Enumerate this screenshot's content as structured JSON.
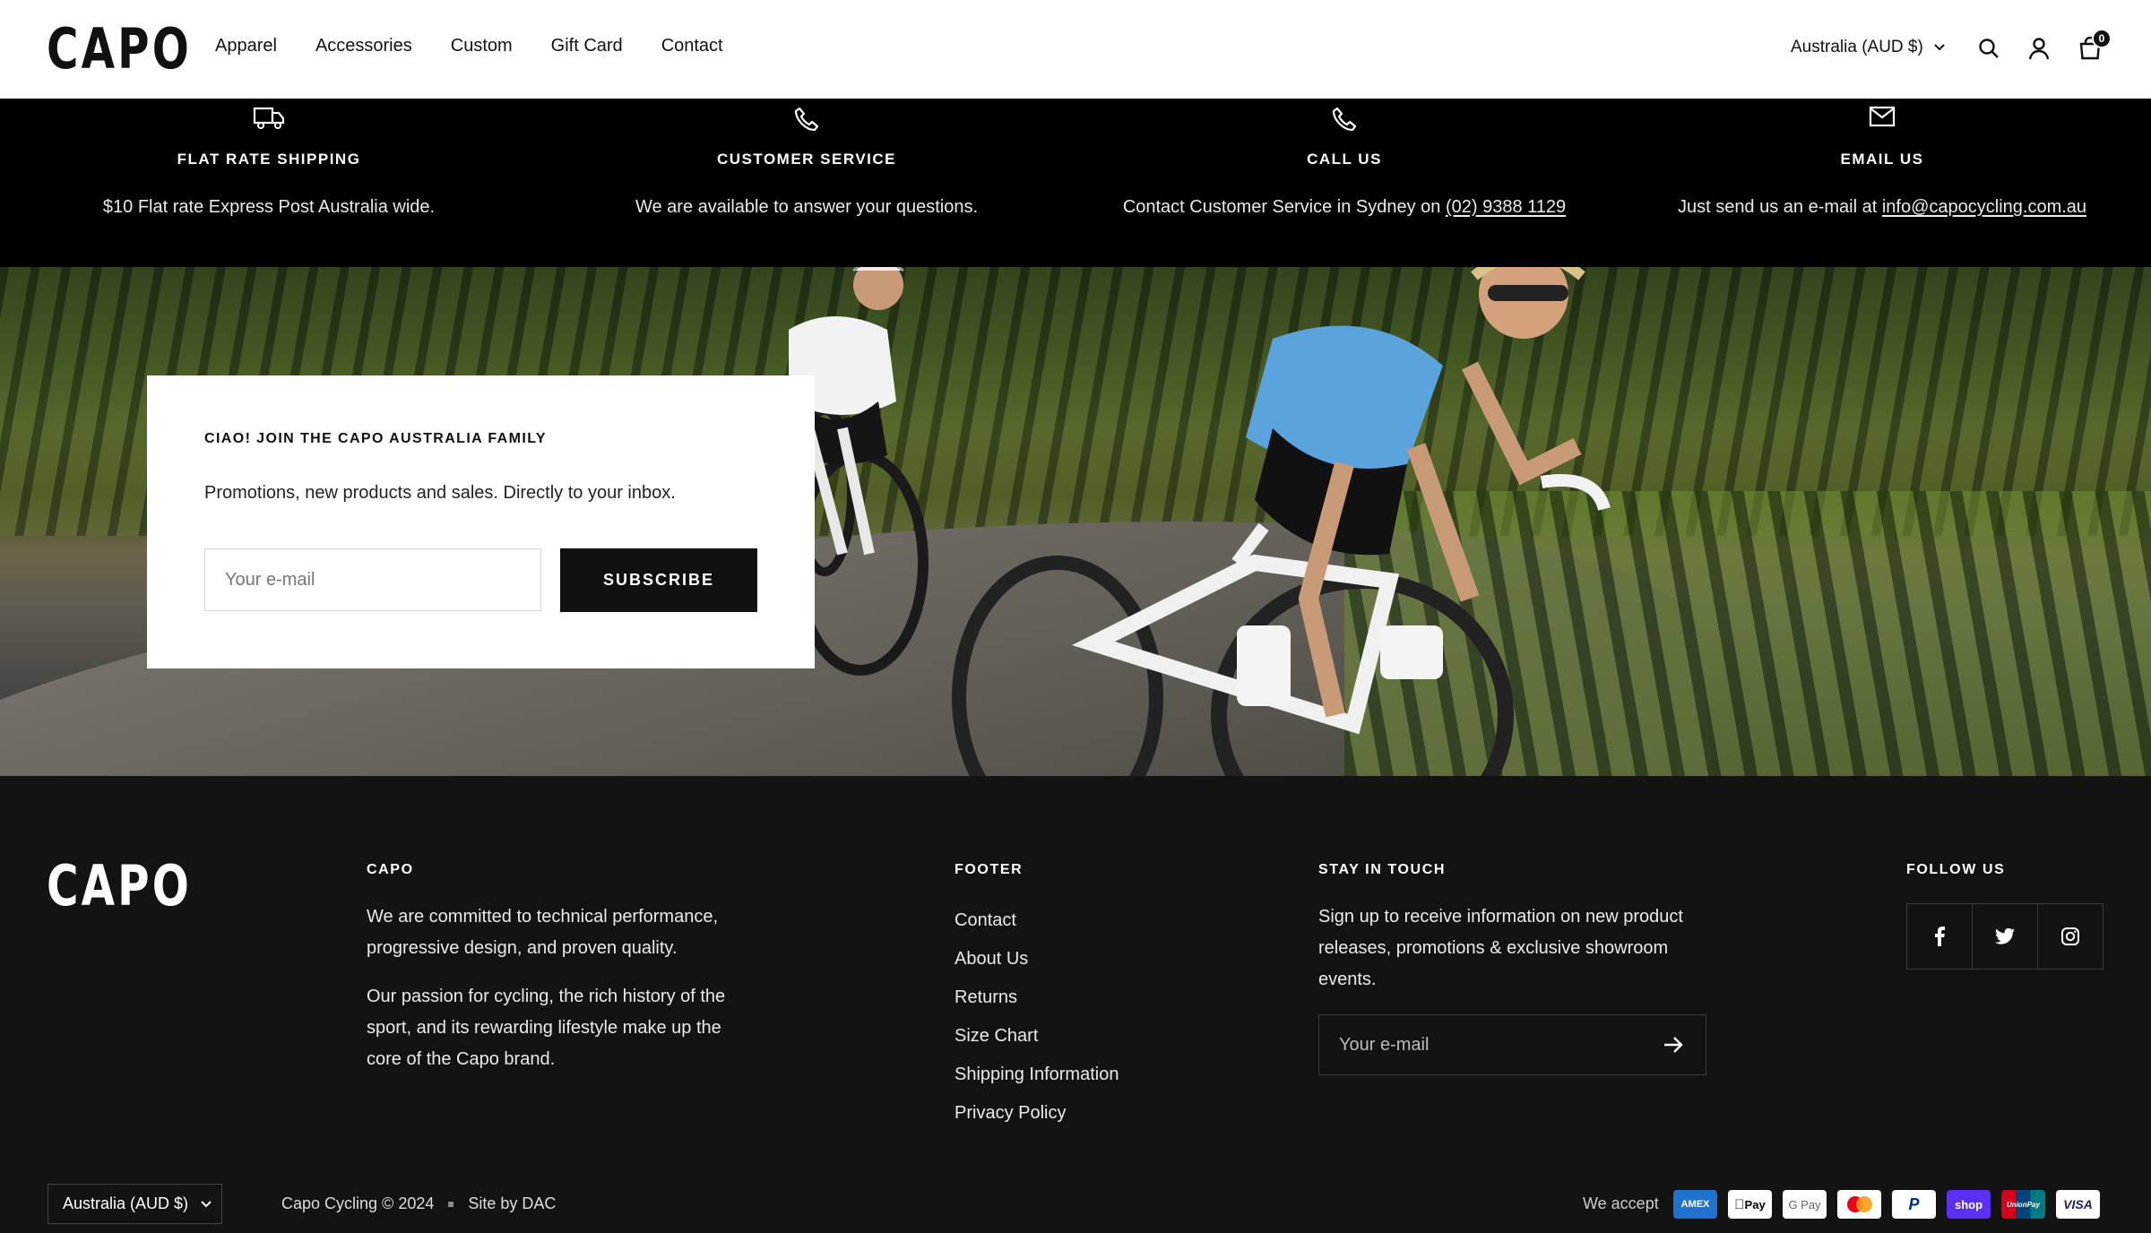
{
  "header": {
    "logo": "CAPO",
    "nav": [
      "Apparel",
      "Accessories",
      "Custom",
      "Gift Card",
      "Contact"
    ],
    "country": "Australia (AUD $)",
    "cart_count": "0"
  },
  "features": [
    {
      "icon": "truck-icon",
      "title": "FLAT RATE SHIPPING",
      "text": "$10 Flat rate Express Post Australia wide.",
      "link": ""
    },
    {
      "icon": "phone-icon",
      "title": "CUSTOMER SERVICE",
      "text": "We are available to answer your questions.",
      "link": ""
    },
    {
      "icon": "phone-icon",
      "title": "CALL US",
      "text": "Contact Customer Service in Sydney on ",
      "link": "(02) 9388 1129"
    },
    {
      "icon": "mail-icon",
      "title": "EMAIL US",
      "text": "Just send us an e-mail at ",
      "link": "info@capocycling.com.au"
    }
  ],
  "newsletter": {
    "title": "CIAO! JOIN THE CAPO AUSTRALIA FAMILY",
    "text": "Promotions, new products and sales. Directly to your inbox.",
    "placeholder": "Your e-mail",
    "button": "SUBSCRIBE"
  },
  "footer": {
    "logo": "CAPO",
    "capo_heading": "CAPO",
    "capo_text_1": "We are committed to technical performance, progressive design, and proven quality.",
    "capo_text_2": "Our passion for cycling, the rich history of the sport, and its rewarding lifestyle make up the core of the Capo brand.",
    "links_heading": "FOOTER",
    "links": [
      "Contact",
      "About Us",
      "Returns",
      "Size Chart",
      "Shipping Information",
      "Privacy Policy"
    ],
    "stay_heading": "STAY IN TOUCH",
    "stay_text": "Sign up to receive information on new product releases, promotions & exclusive showroom events.",
    "stay_placeholder": "Your e-mail",
    "follow_heading": "FOLLOW US",
    "country": "Australia (AUD $)",
    "copyright": "Capo Cycling © 2024",
    "site_by": "Site by DAC",
    "we_accept": "We accept",
    "payments": [
      "AMEX",
      "Pay",
      "G Pay",
      "",
      "P",
      "shop",
      "UnionPay",
      "VISA"
    ]
  },
  "colors": {
    "black": "#000000",
    "footer_bg": "#131313",
    "amex": "#1f72cd",
    "shop": "#5a31f4",
    "visa": "#1a1f71"
  }
}
